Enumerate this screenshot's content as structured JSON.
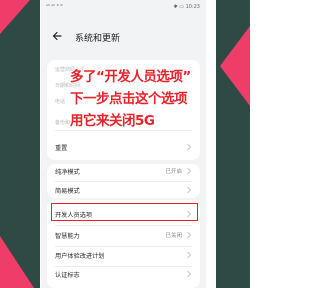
{
  "status_bar": {
    "left": "ᵃᴵˡ ᵃᴵˡ ⁹ ᴺ",
    "right": "✱ ▭ 10:23"
  },
  "header": {
    "title": "系统和更新"
  },
  "faded_items": [
    "运营商网入设",
    "日期和时间",
    "电话",
    "备份和恢复"
  ],
  "rows": [
    {
      "label": "重置",
      "value": ""
    },
    {
      "label": "纯净模式",
      "value": "已开启"
    },
    {
      "label": "简易模式",
      "value": ""
    },
    {
      "label": "开发人员选项",
      "value": ""
    },
    {
      "label": "智慧能力",
      "value": "已关闭"
    },
    {
      "label": "用户体验改进计划",
      "value": ""
    },
    {
      "label": "认证标志",
      "value": ""
    }
  ],
  "overlay": {
    "line1": "多了“开发人员选项”",
    "line2": "下一步点击这个选项",
    "line3": "用它来关闭5G"
  },
  "colors": {
    "accent_red": "#e8232b",
    "deco_pink": "#ee3d69",
    "deco_green": "#2f4a44"
  }
}
